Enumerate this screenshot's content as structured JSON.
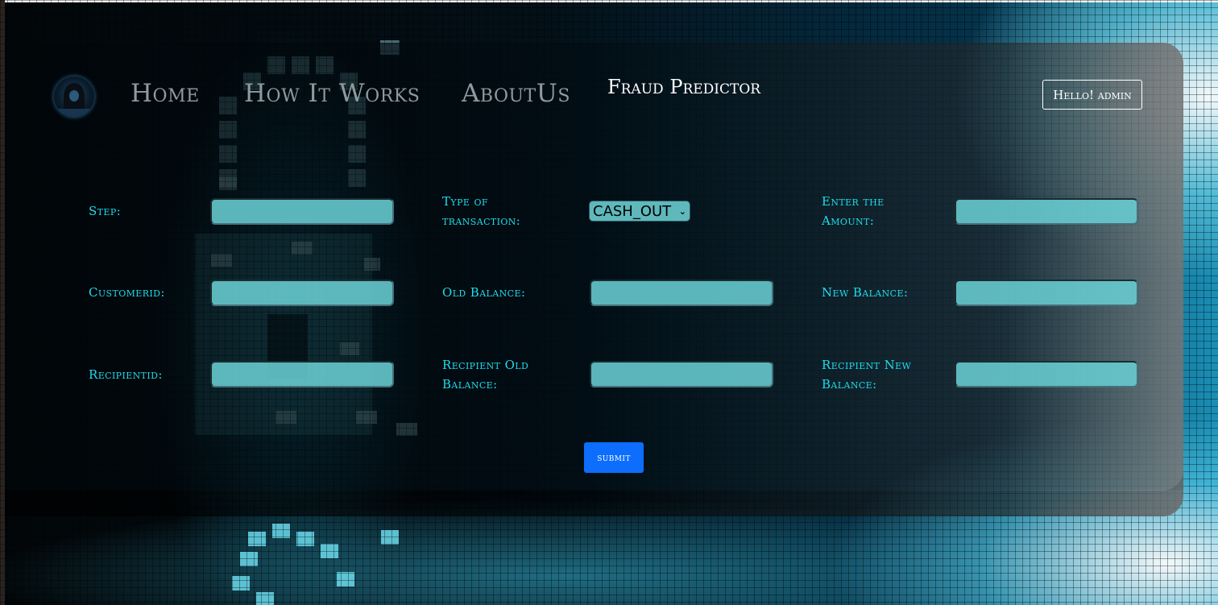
{
  "nav": {
    "items": [
      {
        "label": "Home"
      },
      {
        "label": "How It Works"
      },
      {
        "label": "AboutUs"
      }
    ],
    "active_label": "Fraud Predictor",
    "user_button": "Hello! admin",
    "logo_icon": "hacker-avatar-icon"
  },
  "form": {
    "fields": {
      "step": {
        "label": "Step:",
        "value": ""
      },
      "type": {
        "label": "Type of transaction:",
        "selected": "CASH_OUT"
      },
      "amount": {
        "label": "Enter the Amount:",
        "value": ""
      },
      "customer_id": {
        "label": "Customerid:",
        "value": ""
      },
      "old_balance": {
        "label": "Old Balance:",
        "value": ""
      },
      "new_balance": {
        "label": "New Balance:",
        "value": ""
      },
      "recipient_id": {
        "label": "Recipientid:",
        "value": ""
      },
      "recipient_old_balance": {
        "label": "Recipient Old Balance:",
        "value": ""
      },
      "recipient_new_balance": {
        "label": "Recipient New Balance:",
        "value": ""
      }
    },
    "submit_label": "submit"
  },
  "colors": {
    "label": "#1fdcec",
    "input_bg": "#68cdd2",
    "submit_bg": "#0d6efd",
    "nav_inactive": "#8f9aa0",
    "nav_active": "#ffffff"
  }
}
